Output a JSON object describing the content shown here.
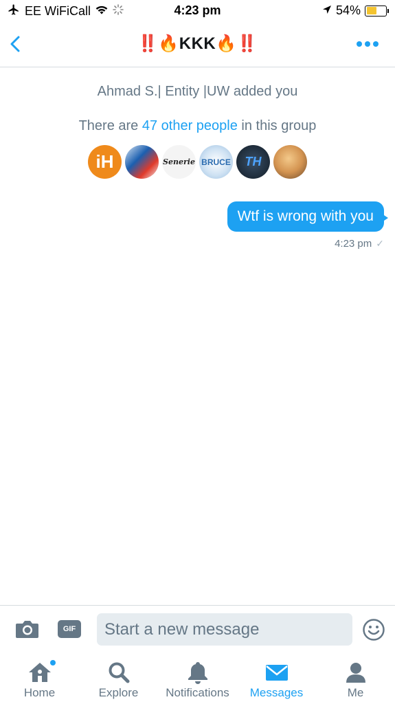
{
  "status_bar": {
    "carrier": "EE WiFiCall",
    "time": "4:23 pm",
    "battery_percent": "54%",
    "battery_level": 0.54,
    "battery_color": "#f4c430",
    "icons": [
      "airplane-icon",
      "wifi-icon",
      "activity-spinner-icon",
      "location-arrow-icon",
      "battery-icon"
    ]
  },
  "header": {
    "title": "‼️🔥KKK🔥‼️",
    "back_icon": "chevron-left-icon",
    "more_icon": "more-dots-icon"
  },
  "conversation": {
    "added_notice": "Ahmad S.| Entity |UW added you",
    "group_count_prefix": "There are ",
    "group_count_link": "47 other people",
    "group_count_suffix": " in this group",
    "members": [
      {
        "initials": "iH"
      },
      {
        "initials": ""
      },
      {
        "initials": "Senerie"
      },
      {
        "initials": "BRUCE"
      },
      {
        "initials": "TH"
      },
      {
        "initials": ""
      }
    ],
    "messages": [
      {
        "text": "Wtf is wrong with you",
        "time": "4:23 pm",
        "status": "✓"
      }
    ]
  },
  "composer": {
    "placeholder": "Start a new message",
    "gif_label": "GIF",
    "icons": [
      "camera-icon",
      "gif-icon",
      "emoji-icon"
    ]
  },
  "tabbar": {
    "tabs": [
      {
        "label": "Home",
        "icon": "home-icon"
      },
      {
        "label": "Explore",
        "icon": "search-icon"
      },
      {
        "label": "Notifications",
        "icon": "bell-icon"
      },
      {
        "label": "Messages",
        "icon": "envelope-icon"
      },
      {
        "label": "Me",
        "icon": "person-icon"
      }
    ],
    "active_tab": "Messages"
  },
  "colors": {
    "accent": "#1da1f2",
    "muted": "#657786",
    "input_bg": "#e6ecf0"
  }
}
